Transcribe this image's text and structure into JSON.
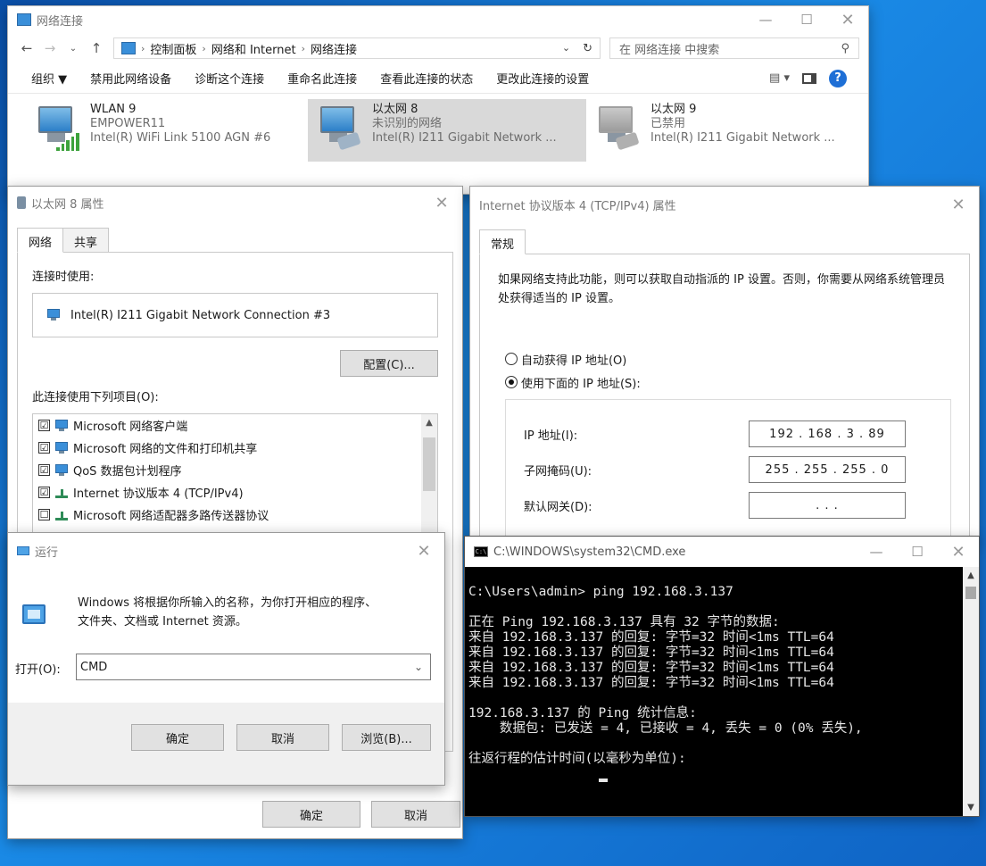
{
  "explorer": {
    "title": "网络连接",
    "breadcrumb": [
      "控制面板",
      "网络和 Internet",
      "网络连接"
    ],
    "search_placeholder": "在 网络连接 中搜索",
    "commands": [
      "组织 ▼",
      "禁用此网络设备",
      "诊断这个连接",
      "重命名此连接",
      "查看此连接的状态",
      "更改此连接的设置"
    ],
    "items": [
      {
        "name": "WLAN 9",
        "status": "EMPOWER11",
        "adapter": "Intel(R) WiFi Link 5100 AGN #6"
      },
      {
        "name": "以太网 8",
        "status": "未识别的网络",
        "adapter": "Intel(R) I211 Gigabit Network ..."
      },
      {
        "name": "以太网 9",
        "status": "已禁用",
        "adapter": "Intel(R) I211 Gigabit Network ..."
      }
    ]
  },
  "eth_props": {
    "title": "以太网 8 属性",
    "tabs": [
      "网络",
      "共享"
    ],
    "connect_using_label": "连接时使用:",
    "adapter": "Intel(R) I211 Gigabit Network Connection #3",
    "configure_button": "配置(C)...",
    "items_label": "此连接使用下列项目(O):",
    "items": [
      {
        "label": "Microsoft 网络客户端",
        "checked": "☑"
      },
      {
        "label": "Microsoft 网络的文件和打印机共享",
        "checked": "☑"
      },
      {
        "label": "QoS 数据包计划程序",
        "checked": "☑"
      },
      {
        "label": "Internet 协议版本 4 (TCP/IPv4)",
        "checked": "☑"
      },
      {
        "label": "Microsoft 网络适配器多路传送器协议",
        "checked": "☐"
      }
    ],
    "ok": "确定",
    "cancel": "取消"
  },
  "ipv4": {
    "title": "Internet 协议版本 4 (TCP/IPv4) 属性",
    "tab": "常规",
    "description": "如果网络支持此功能，则可以获取自动指派的 IP 设置。否则，你需要从网络系统管理员处获得适当的 IP 设置。",
    "auto_ip": "自动获得 IP 地址(O)",
    "manual_ip": "使用下面的 IP 地址(S):",
    "ip_label": "IP 地址(I):",
    "ip_value": "192 . 168 .  3  . 89",
    "mask_label": "子网掩码(U):",
    "mask_value": "255 . 255 . 255 .  0",
    "gateway_label": "默认网关(D):",
    "gateway_value": ".     .     ."
  },
  "run": {
    "title": "运行",
    "description_l1": "Windows 将根据你所输入的名称，为你打开相应的程序、",
    "description_l2": "文件夹、文档或 Internet 资源。",
    "open_label": "打开(O):",
    "open_value": "CMD",
    "ok": "确定",
    "cancel": "取消",
    "browse": "浏览(B)..."
  },
  "cmd": {
    "title": "C:\\WINDOWS\\system32\\CMD.exe",
    "lines": [
      "C:\\Users\\admin> ping 192.168.3.137",
      "",
      "正在 Ping 192.168.3.137 具有 32 字节的数据:",
      "来自 192.168.3.137 的回复: 字节=32 时间<1ms TTL=64",
      "来自 192.168.3.137 的回复: 字节=32 时间<1ms TTL=64",
      "来自 192.168.3.137 的回复: 字节=32 时间<1ms TTL=64",
      "来自 192.168.3.137 的回复: 字节=32 时间<1ms TTL=64",
      "",
      "192.168.3.137 的 Ping 统计信息:",
      "    数据包: 已发送 = 4, 已接收 = 4, 丢失 = 0 (0% 丢失),",
      "",
      "往返行程的估计时间(以毫秒为单位):"
    ]
  }
}
